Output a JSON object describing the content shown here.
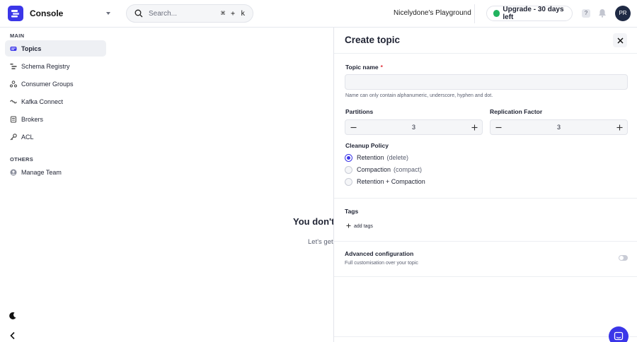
{
  "header": {
    "app_title": "Console",
    "search_placeholder": "Search...",
    "search_shortcut": "⌘ + k",
    "org_name": "Nicelydone's Playground",
    "upgrade_label": "Upgrade - 30 days left",
    "avatar_initials": "PR"
  },
  "sidebar": {
    "main_label": "MAIN",
    "items": [
      {
        "label": "Topics",
        "icon": "topics-icon",
        "active": true
      },
      {
        "label": "Schema Registry",
        "icon": "schema-icon"
      },
      {
        "label": "Consumer Groups",
        "icon": "consumer-groups-icon"
      },
      {
        "label": "Kafka Connect",
        "icon": "connect-icon"
      },
      {
        "label": "Brokers",
        "icon": "brokers-icon"
      },
      {
        "label": "ACL",
        "icon": "key-icon"
      }
    ],
    "others_label": "OTHERS",
    "others_items": [
      {
        "label": "Manage Team",
        "icon": "team-icon"
      }
    ]
  },
  "empty_state": {
    "title": "You don't",
    "subtitle": "Let's get"
  },
  "drawer": {
    "title": "Create topic",
    "topic_name_label": "Topic name",
    "required_mark": "*",
    "topic_name_value": "",
    "topic_name_hint": "Name can only contain alphanumeric, underscore, hyphen and dot.",
    "partitions_label": "Partitions",
    "partitions_value": "3",
    "replication_label": "Replication Factor",
    "replication_value": "3",
    "cleanup_label": "Cleanup Policy",
    "cleanup_options": [
      {
        "main": "Retention",
        "sub": "(delete)",
        "selected": true
      },
      {
        "main": "Compaction",
        "sub": "(compact)",
        "selected": false
      },
      {
        "main": "Retention + Compaction",
        "sub": "",
        "selected": false
      }
    ],
    "tags_label": "Tags",
    "add_tags_label": "add tags",
    "advanced_title": "Advanced configuration",
    "advanced_subtitle": "Full customisation over your topic",
    "advanced_enabled": false
  },
  "colors": {
    "accent": "#3b36e8",
    "success": "#22b35e",
    "required": "#e0323c"
  }
}
